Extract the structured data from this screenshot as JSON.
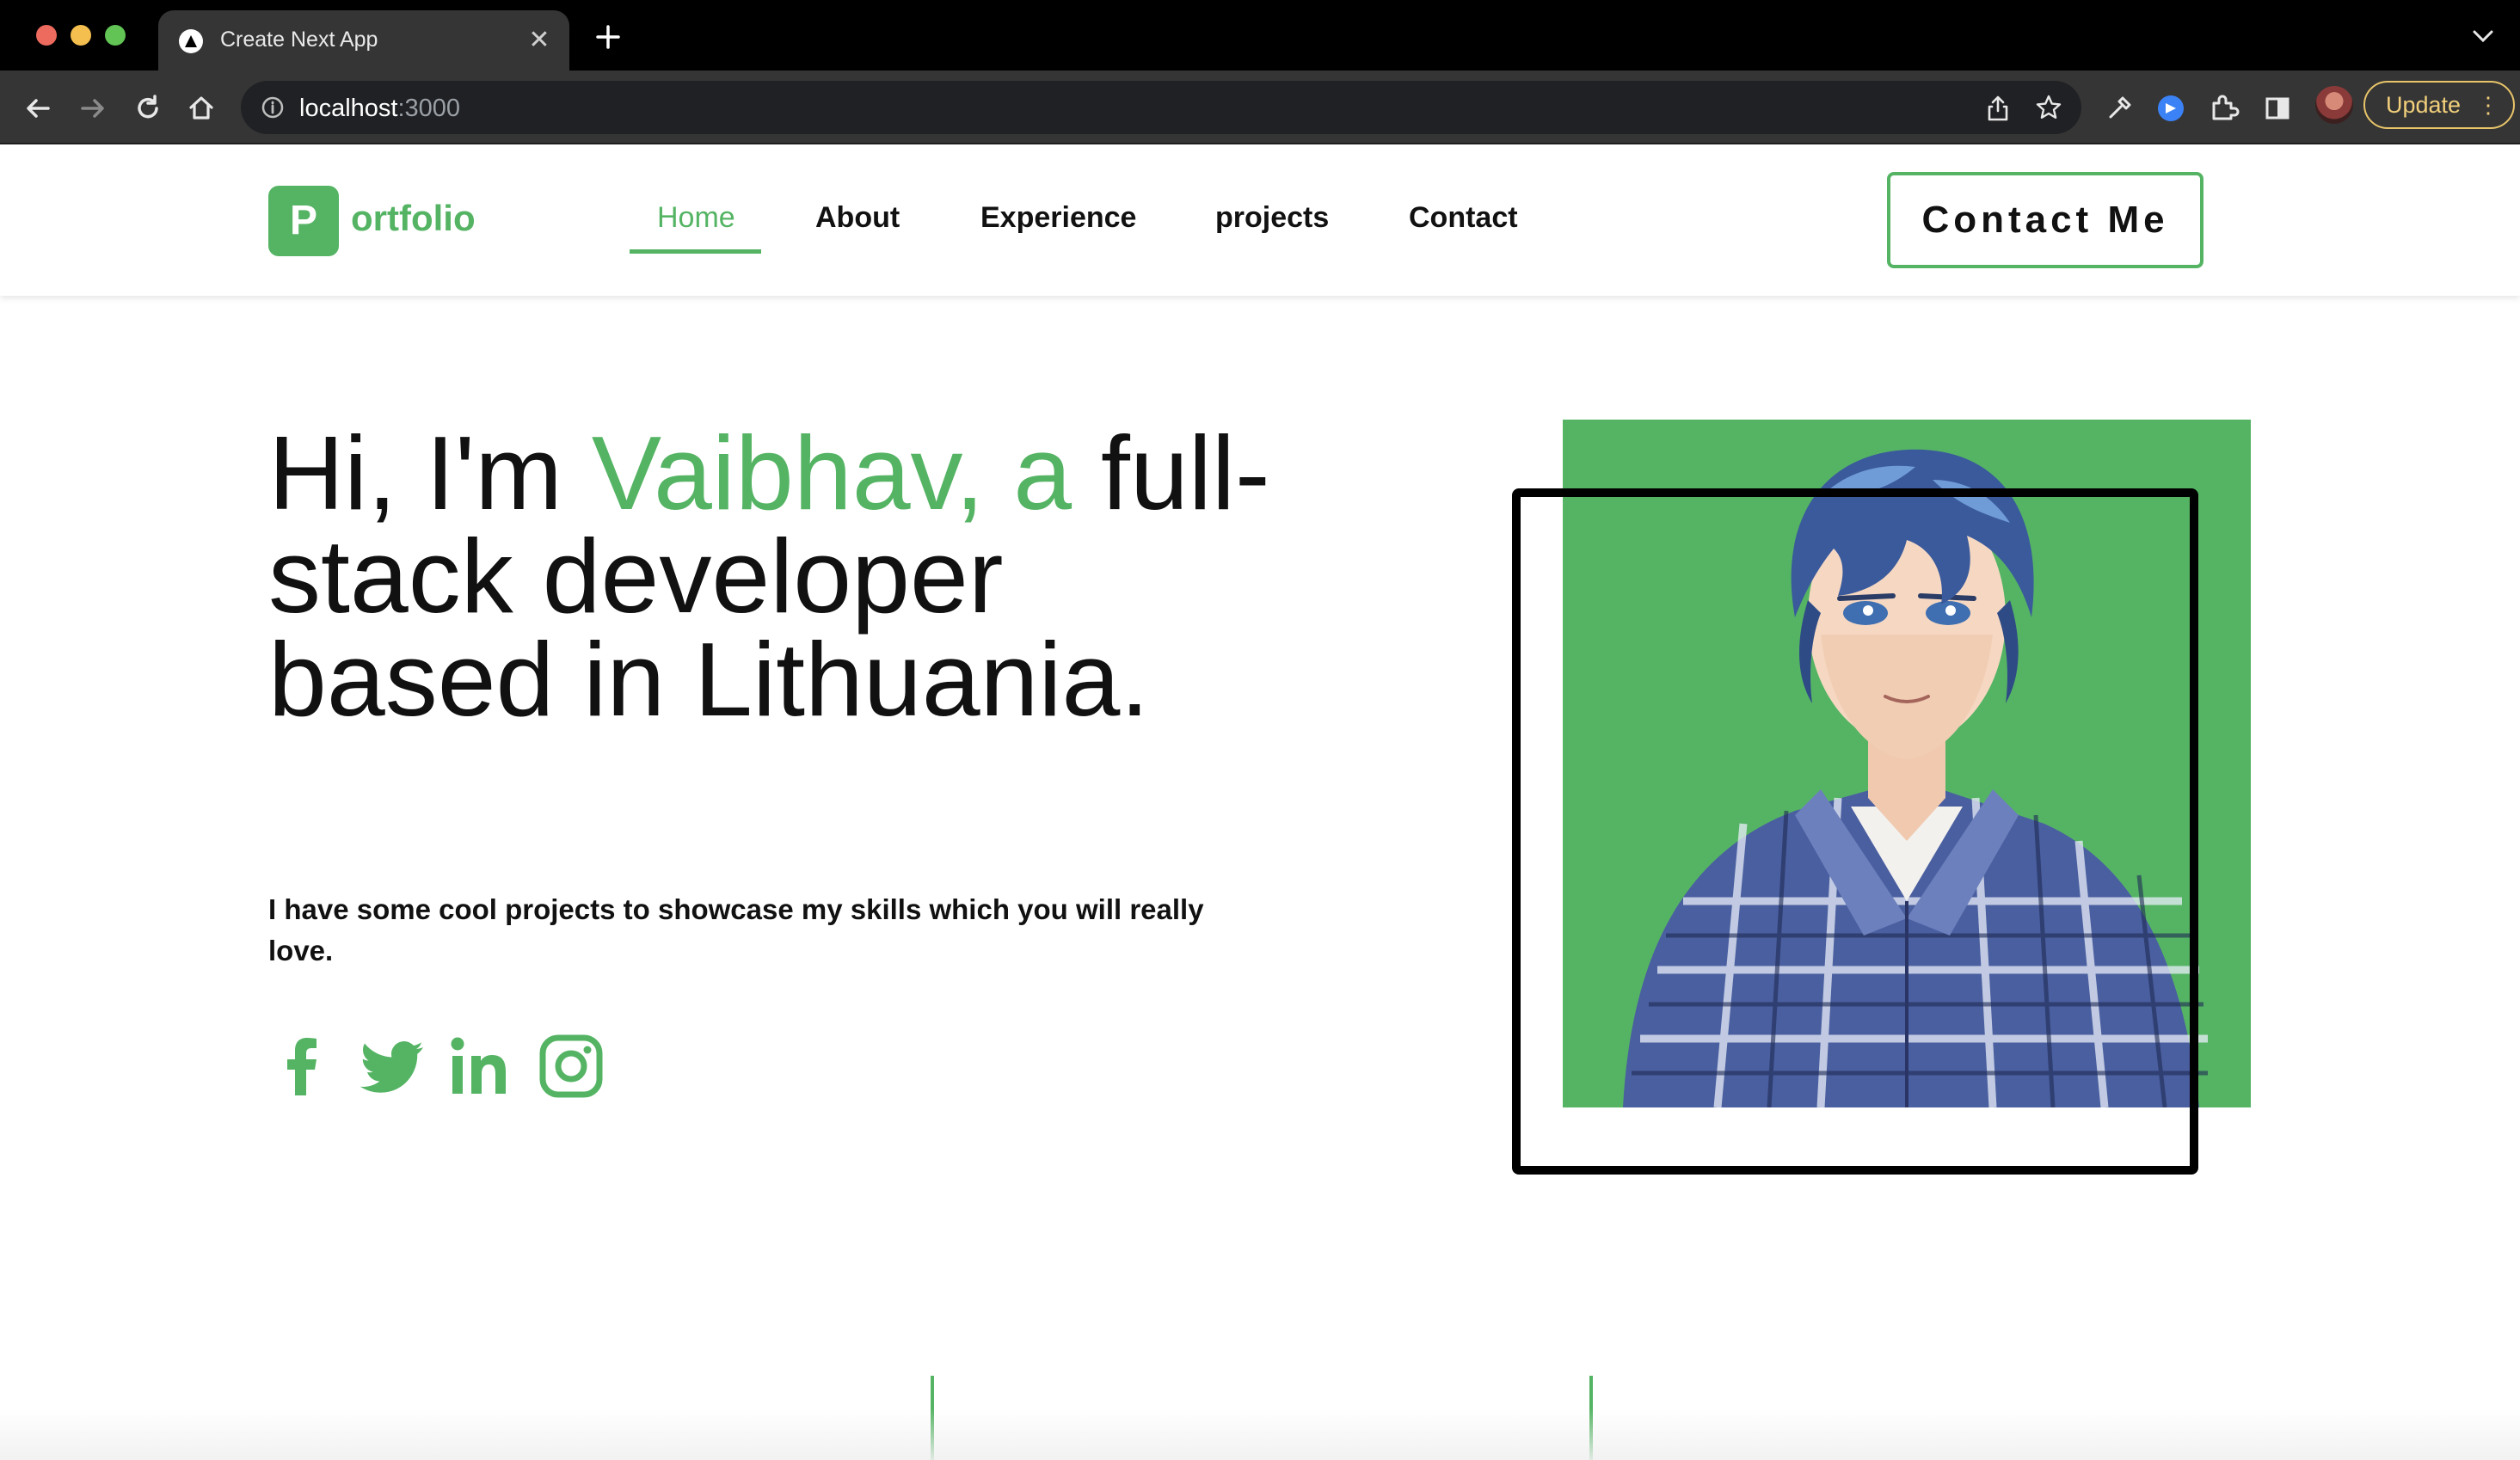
{
  "browser": {
    "tab_title": "Create Next App",
    "url_host": "localhost",
    "url_port": ":3000",
    "update_label": "Update"
  },
  "header": {
    "logo_letter": "P",
    "logo_text": "ortfolio",
    "nav": [
      "Home",
      "About",
      "Experience",
      "projects",
      "Contact"
    ],
    "active_nav": "Home",
    "cta_label": "Contact Me"
  },
  "hero": {
    "title_prefix": "Hi, I'm ",
    "title_accent": "Vaibhav, a",
    "title_rest": "full-stack developer based in Lithuania.",
    "subtitle": "I have some cool projects to showcase my skills which you will really love.",
    "socials": [
      "facebook-icon",
      "twitter-icon",
      "linkedin-icon",
      "instagram-icon"
    ]
  },
  "colors": {
    "accent": "#55b464",
    "text": "#111111",
    "chrome_bg": "#353535"
  }
}
